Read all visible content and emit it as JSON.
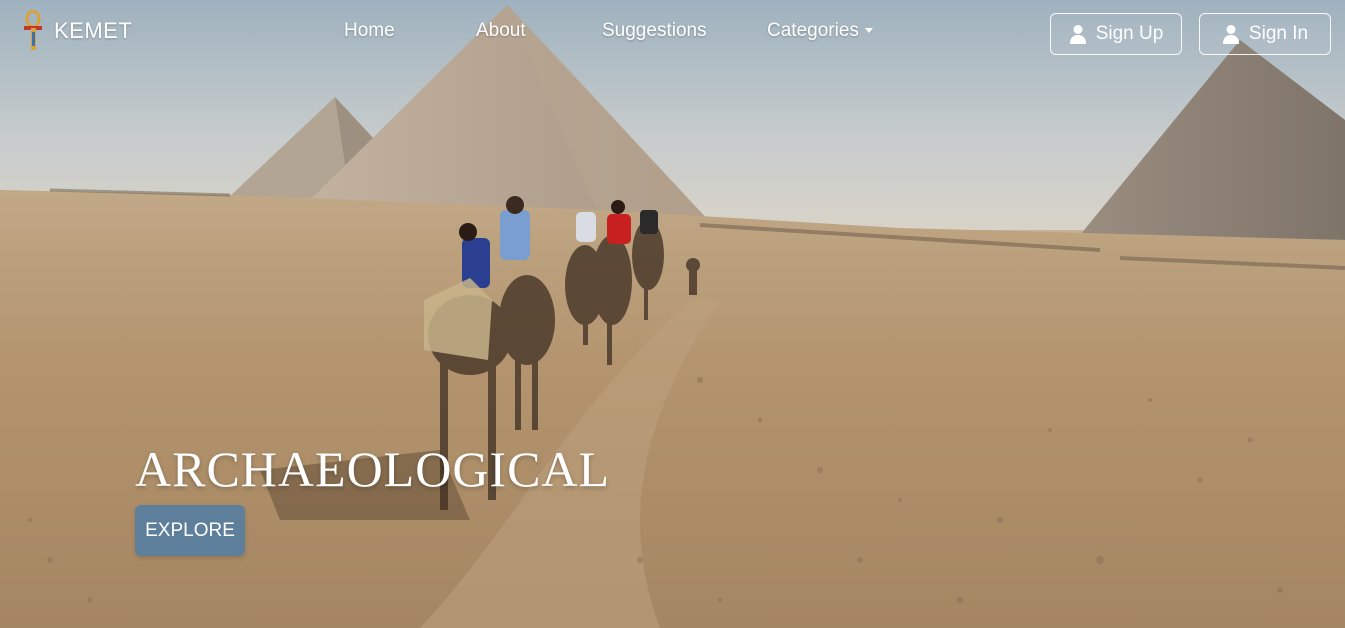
{
  "brand": {
    "name": "KEMET",
    "logo_icon": "ankh-logo-icon"
  },
  "nav": {
    "home": "Home",
    "about": "About",
    "suggestions": "Suggestions",
    "categories": "Categories"
  },
  "auth": {
    "sign_up": "Sign Up",
    "sign_in": "Sign In",
    "icon": "user-icon"
  },
  "hero": {
    "title": "ARCHAEOLOGICAL",
    "cta": "EXPLORE",
    "cta_color": "#5e7f9b"
  }
}
